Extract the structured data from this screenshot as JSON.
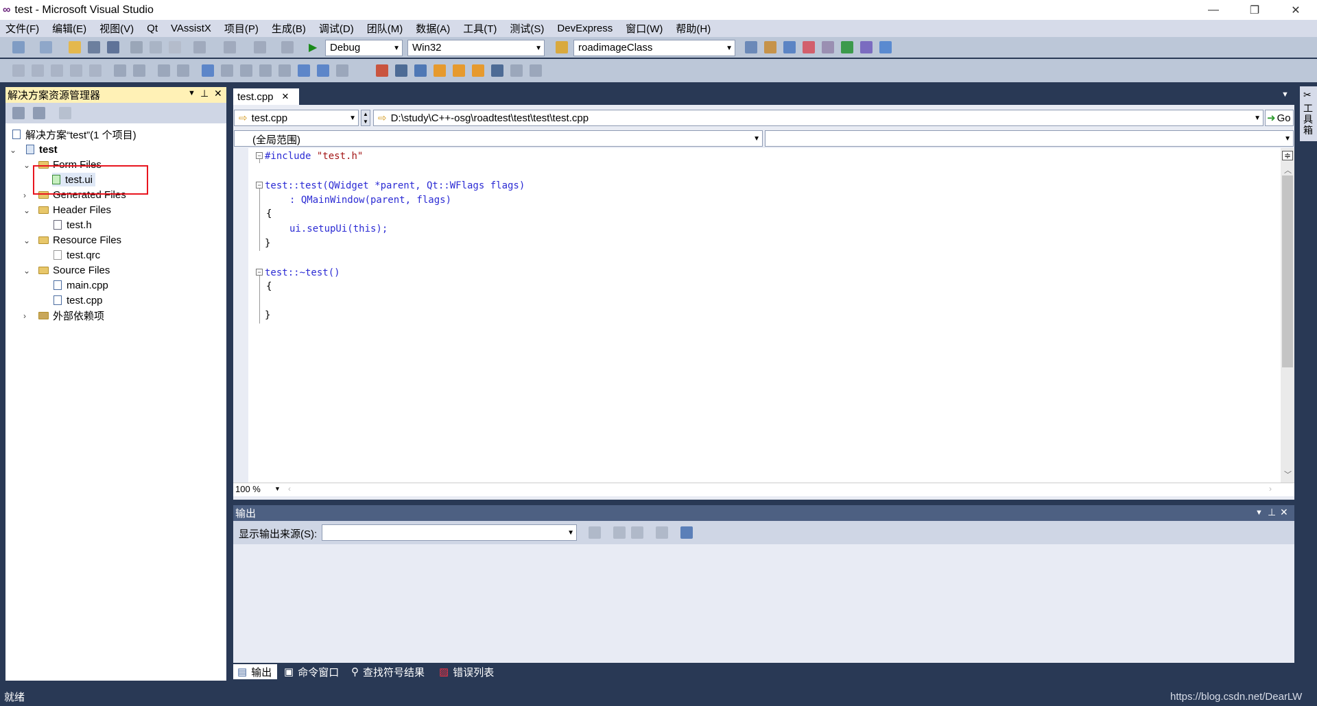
{
  "window": {
    "title": "test - Microsoft Visual Studio",
    "minimize": "—",
    "restore": "❐",
    "close": "✕"
  },
  "menu": [
    "文件(F)",
    "编辑(E)",
    "视图(V)",
    "Qt",
    "VAssistX",
    "项目(P)",
    "生成(B)",
    "调试(D)",
    "团队(M)",
    "数据(A)",
    "工具(T)",
    "测试(S)",
    "DevExpress",
    "窗口(W)",
    "帮助(H)"
  ],
  "toolbar": {
    "config": "Debug",
    "platform": "Win32",
    "find": "roadimageClass"
  },
  "solution_explorer": {
    "title": "解决方案资源管理器",
    "items": [
      {
        "label": "解决方案“test”(1 个项目)"
      },
      {
        "label": "test"
      },
      {
        "label": "Form Files"
      },
      {
        "label": "test.ui"
      },
      {
        "label": "Generated Files"
      },
      {
        "label": "Header Files"
      },
      {
        "label": "test.h"
      },
      {
        "label": "Resource Files"
      },
      {
        "label": "test.qrc"
      },
      {
        "label": "Source Files"
      },
      {
        "label": "main.cpp"
      },
      {
        "label": "test.cpp"
      },
      {
        "label": "外部依赖项"
      }
    ]
  },
  "editor": {
    "tab": "test.cpp",
    "file_combo": "test.cpp",
    "path_combo": "D:\\study\\C++-osg\\roadtest\\test\\test\\test.cpp",
    "go_label": "Go",
    "scope": "(全局范围)",
    "zoom": "100 %",
    "code": {
      "l1_kw": "#include",
      "l1_str": "\"test.h\"",
      "l3": "test::test(QWidget *parent, Qt::WFlags flags)",
      "l4": ": QMainWindow(parent, flags)",
      "l5": "{",
      "l6": "ui.setupUi(this);",
      "l7": "}",
      "l9": "test::~test()",
      "l10": "{",
      "l12": "}"
    }
  },
  "output": {
    "title": "输出",
    "source_label": "显示输出来源(S):",
    "source_value": ""
  },
  "bottom_tabs": [
    "输出",
    "命令窗口",
    "查找符号结果",
    "错误列表"
  ],
  "side_strip": "工具箱",
  "status": {
    "text": "就绪",
    "watermark": "https://blog.csdn.net/DearLW"
  }
}
